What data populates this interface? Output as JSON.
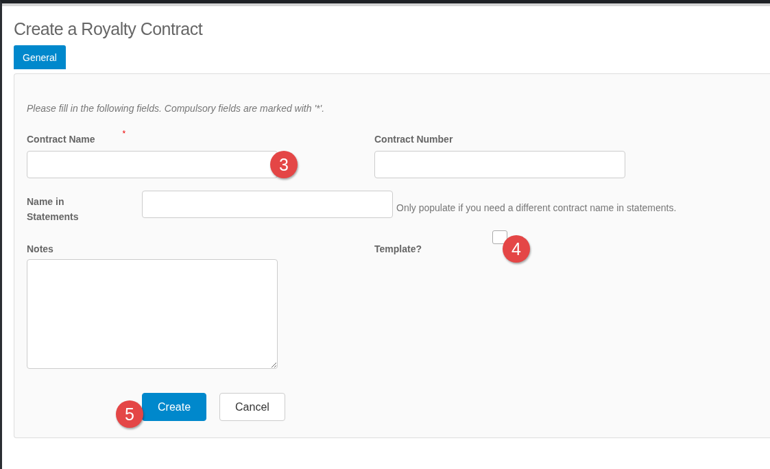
{
  "title": "Create a Royalty Contract",
  "tabs": [
    {
      "label": "General",
      "selected": true
    }
  ],
  "intro": "Please fill in the following fields. Compulsory fields are marked with '*'.",
  "fields": {
    "contract_name": {
      "label": "Contract Name",
      "required_mark": "*",
      "callout": "3"
    },
    "contract_number": {
      "label": "Contract Number"
    },
    "name_in_statements": {
      "label": "Name in Statements",
      "help": "Only populate if you need a different contract name in statements."
    },
    "notes": {
      "label": "Notes"
    },
    "template": {
      "label": "Template?",
      "checked": false,
      "callout": "4"
    }
  },
  "buttons": [
    {
      "label": "Create",
      "kind": "primary",
      "callout": "5"
    },
    {
      "label": "Cancel",
      "kind": "default"
    }
  ]
}
